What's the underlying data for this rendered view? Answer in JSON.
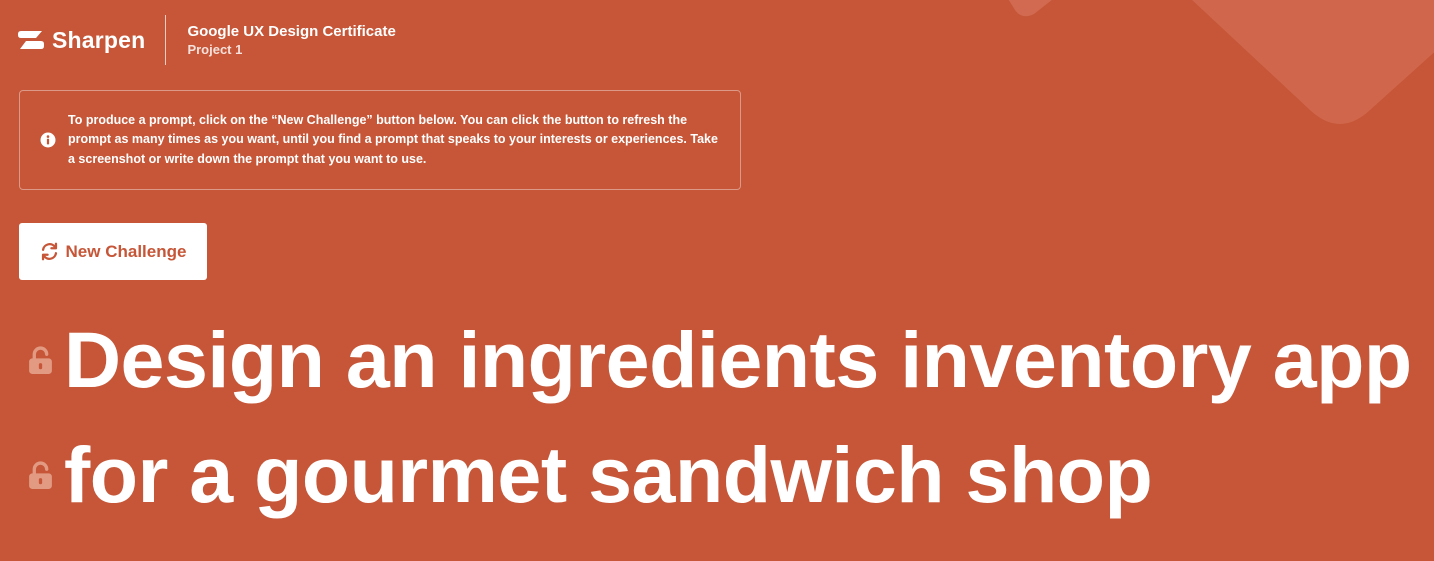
{
  "brand": {
    "name": "Sharpen",
    "logo_icon": "sharpen-logo-icon"
  },
  "course": {
    "title": "Google UX Design Certificate",
    "subtitle": "Project 1"
  },
  "info": {
    "icon": "info-icon",
    "text": "To produce a prompt, click on the “New Challenge” button below. You can click the button to refresh the prompt as many times as you want, until you find a prompt that speaks to your interests or experiences. Take a screenshot or write down the prompt that you want to use."
  },
  "actions": {
    "new_challenge_label": "New Challenge",
    "new_challenge_icon": "refresh-icon"
  },
  "prompt": {
    "line1": "Design an ingredients inventory app",
    "line2": "for a gourmet sandwich shop",
    "lock_icon": "unlock-icon"
  },
  "colors": {
    "background": "#c65637",
    "text": "#ffffff",
    "button_background": "#ffffff",
    "button_text": "#c65637"
  }
}
